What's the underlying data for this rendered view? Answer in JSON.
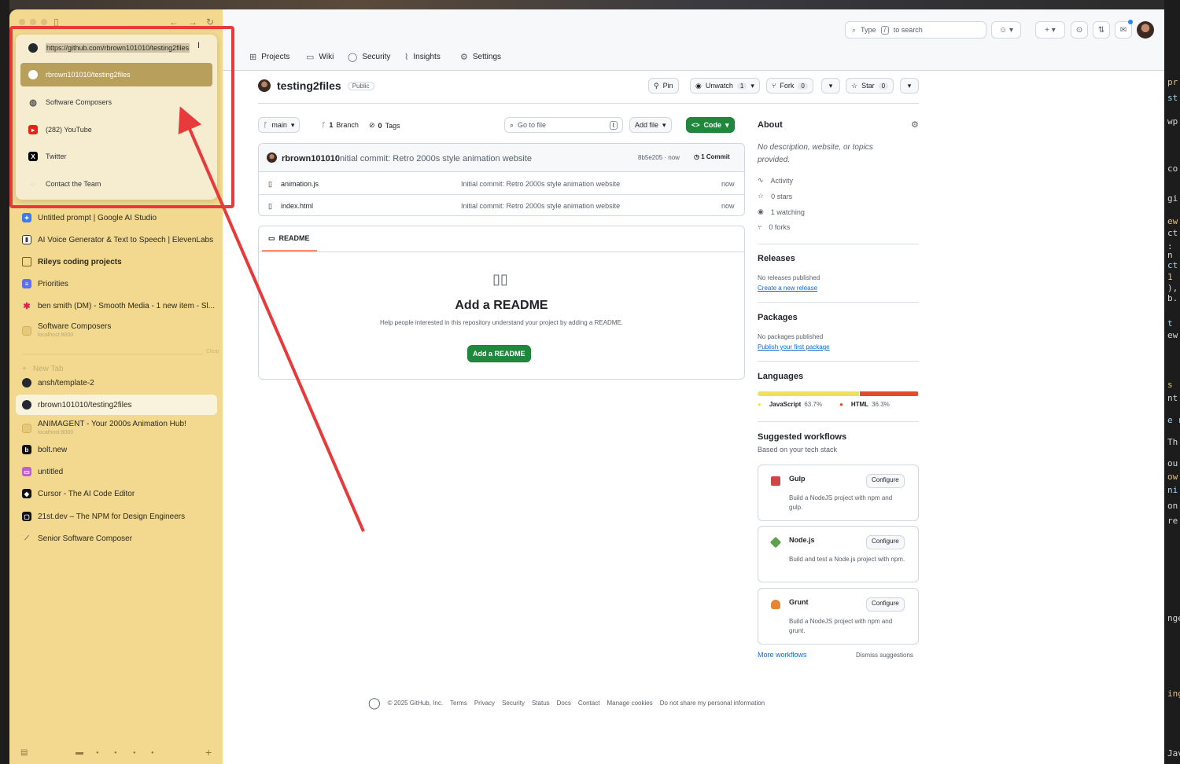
{
  "background_code_fragments": [
    "pr",
    "st",
    "wp",
    "co",
    "gi",
    "ew",
    "ct",
    ":",
    "n",
    "ct",
    "1",
    "),",
    "b.",
    "t",
    "ew",
    "s",
    "nt",
    "e r",
    "Th",
    "ou",
    "ow",
    "ni",
    "on",
    "re",
    "nge",
    "ing",
    "Jav"
  ],
  "popup": {
    "items": [
      {
        "label": "https://github.com/rbrown101010/testing2files",
        "icon": "github-icon",
        "kind": "url"
      },
      {
        "label": "rbrown101010/testing2files",
        "icon": "github-icon",
        "kind": "selected"
      },
      {
        "label": "Software Composers",
        "icon": "globe-icon",
        "kind": "normal"
      },
      {
        "label": "(282) YouTube",
        "icon": "youtube-icon",
        "kind": "normal"
      },
      {
        "label": "Twitter",
        "icon": "x-icon",
        "kind": "normal"
      },
      {
        "label": "Contact the Team",
        "icon": "chat-icon",
        "kind": "normal"
      }
    ]
  },
  "sidebar": {
    "pinned": [
      {
        "label": "Untitled prompt | Google AI Studio",
        "icon": "gemini-icon"
      },
      {
        "label": "AI Voice Generator & Text to Speech | ElevenLabs",
        "icon": "elevenlabs-icon"
      },
      {
        "label": "Rileys coding projects",
        "icon": "folder-icon"
      },
      {
        "label": "Priorities",
        "icon": "priorities-icon"
      },
      {
        "label": "ben smith (DM) - Smooth Media - 1 new item - Sl...",
        "icon": "slack-icon"
      },
      {
        "label": "Software Composers",
        "sub": "localhost:8000",
        "icon": "page-icon"
      }
    ],
    "clear_label": "Clear",
    "new_tab_label": "New Tab",
    "tabs": [
      {
        "label": "ansh/template-2",
        "icon": "github-icon"
      },
      {
        "label": "rbrown101010/testing2files",
        "icon": "github-icon",
        "active": true
      },
      {
        "label": "ANIMAGENT - Your 2000s Animation Hub!",
        "sub": "localhost:8000",
        "icon": "page-icon"
      },
      {
        "label": "bolt.new",
        "icon": "bolt-icon"
      },
      {
        "label": "untitled",
        "icon": "untitled-icon"
      },
      {
        "label": "Cursor - The AI Code Editor",
        "icon": "cursor-icon"
      },
      {
        "label": "21st.dev – The NPM for Design Engineers",
        "icon": "21st-icon"
      },
      {
        "label": "Senior Software Composer",
        "icon": "wand-icon"
      }
    ]
  },
  "header": {
    "search_prefix": "Type",
    "search_key": "/",
    "search_suffix": "to search"
  },
  "repo_nav": [
    {
      "label": "Projects",
      "icon": "table-icon"
    },
    {
      "label": "Wiki",
      "icon": "book-icon"
    },
    {
      "label": "Security",
      "icon": "shield-icon"
    },
    {
      "label": "Insights",
      "icon": "graph-icon"
    },
    {
      "label": "Settings",
      "icon": "gear-icon"
    }
  ],
  "repo": {
    "name": "testing2files",
    "visibility": "Public",
    "pin_label": "Pin",
    "unwatch_label": "Unwatch",
    "unwatch_count": "1",
    "fork_label": "Fork",
    "fork_count": "0",
    "star_label": "Star",
    "star_count": "0"
  },
  "toolbar": {
    "branch": "main",
    "branch_count": "1",
    "branch_label": "Branch",
    "tag_count": "0",
    "tag_label": "Tags",
    "goto_placeholder": "Go to file",
    "goto_key": "t",
    "add_file_label": "Add file",
    "code_label": "Code"
  },
  "commit": {
    "author": "rbrown101010",
    "message": "Initial commit: Retro 2000s style animation website",
    "hash_time": "8b5e205 · now",
    "count_label": "1 Commit"
  },
  "files": [
    {
      "name": "animation.js",
      "message": "Initial commit: Retro 2000s style animation website",
      "time": "now"
    },
    {
      "name": "index.html",
      "message": "Initial commit: Retro 2000s style animation website",
      "time": "now"
    }
  ],
  "readme": {
    "tab_label": "README",
    "title": "Add a README",
    "description": "Help people interested in this repository understand your project by adding a README.",
    "button_label": "Add a README"
  },
  "about": {
    "heading": "About",
    "description": "No description, website, or topics provided.",
    "stats": [
      {
        "label": "Activity",
        "icon": "pulse-icon"
      },
      {
        "label": "0 stars",
        "icon": "star-icon"
      },
      {
        "label": "1 watching",
        "icon": "eye-icon"
      },
      {
        "label": "0 forks",
        "icon": "fork-icon"
      }
    ]
  },
  "releases": {
    "heading": "Releases",
    "text": "No releases published",
    "link": "Create a new release"
  },
  "packages": {
    "heading": "Packages",
    "text": "No packages published",
    "link": "Publish your first package"
  },
  "languages": {
    "heading": "Languages",
    "items": [
      {
        "name": "JavaScript",
        "percent": "63.7%",
        "value": 63.7,
        "color": "#f1e05a"
      },
      {
        "name": "HTML",
        "percent": "36.3%",
        "value": 36.3,
        "color": "#e34c26"
      }
    ]
  },
  "workflows": {
    "heading": "Suggested workflows",
    "subheading": "Based on your tech stack",
    "configure_label": "Configure",
    "items": [
      {
        "name": "Gulp",
        "desc": "Build a NodeJS project with npm and gulp.",
        "color": "#cf4647"
      },
      {
        "name": "Node.js",
        "desc": "Build and test a Node.js project with npm.",
        "color": "#5fa04e"
      },
      {
        "name": "Grunt",
        "desc": "Build a NodeJS project with npm and grunt.",
        "color": "#e48632"
      }
    ],
    "more_link": "More workflows",
    "dismiss_link": "Dismiss suggestions"
  },
  "footer": {
    "copyright": "© 2025 GitHub, Inc.",
    "links": [
      "Terms",
      "Privacy",
      "Security",
      "Status",
      "Docs",
      "Contact",
      "Manage cookies",
      "Do not share my personal information"
    ]
  }
}
